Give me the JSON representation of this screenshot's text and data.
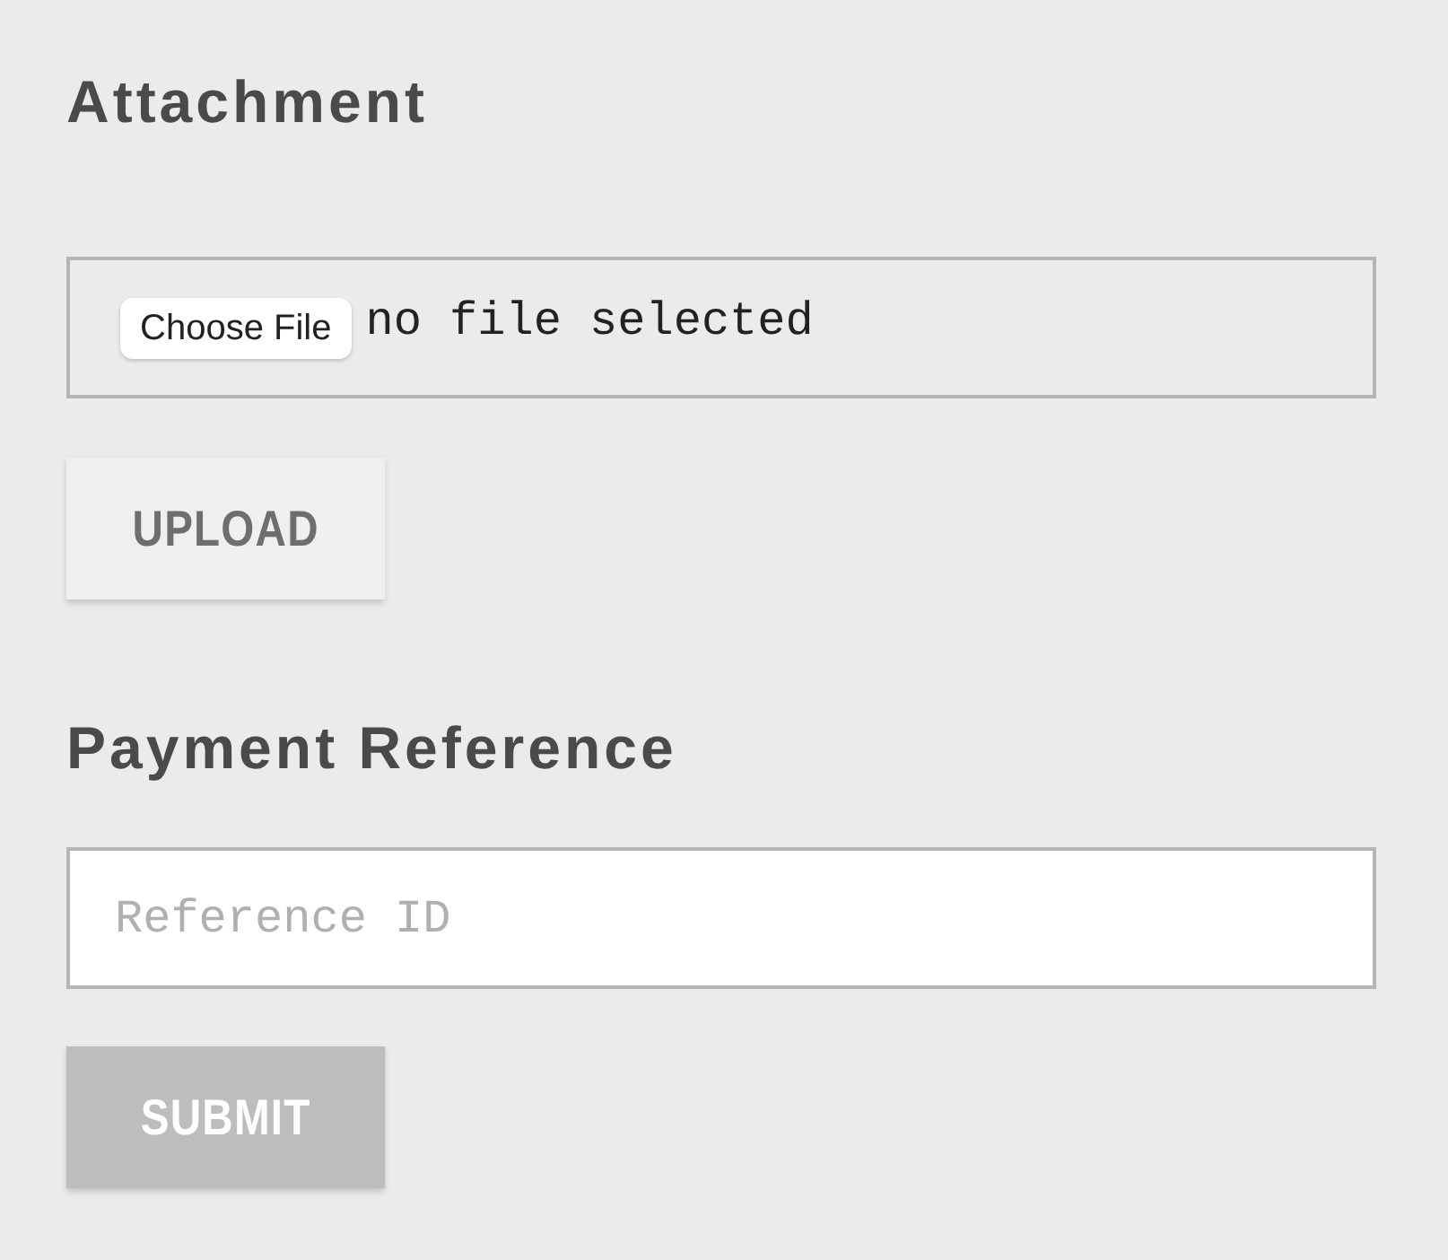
{
  "attachment": {
    "title": "Attachment",
    "file_button": "Choose File",
    "file_status": "no file selected"
  },
  "upload_button": {
    "label": "UPLOAD",
    "disabled": false
  },
  "payment_reference": {
    "title": "Payment Reference",
    "placeholder": "Reference ID"
  },
  "submit_button": {
    "label": "SUBMIT",
    "disabled": true
  }
}
